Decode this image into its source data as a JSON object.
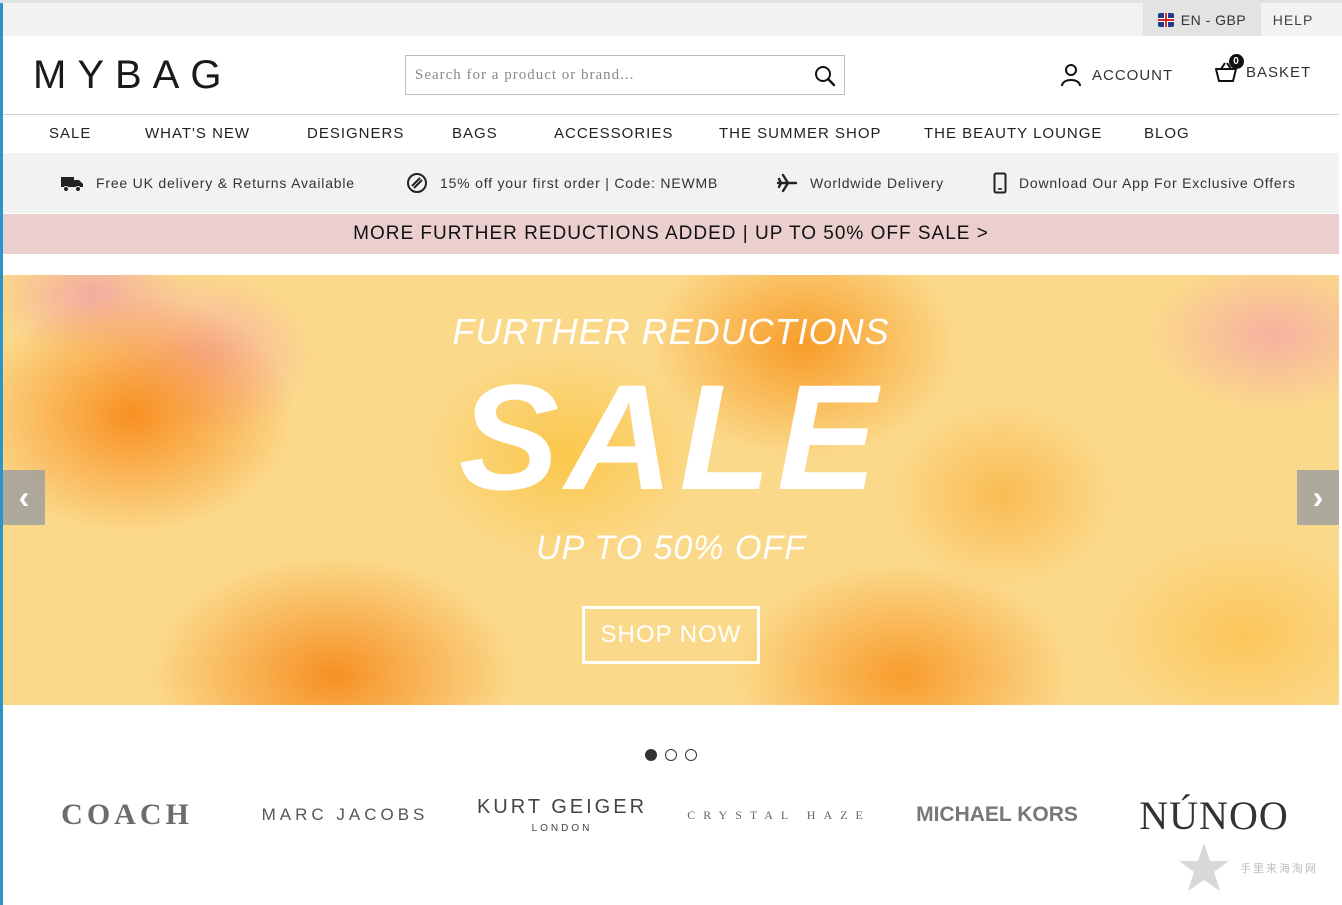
{
  "utility": {
    "locale": "EN - GBP",
    "help": "HELP"
  },
  "header": {
    "logo": "MYBAG",
    "search": {
      "placeholder": "Search for a product or brand..."
    },
    "account": "ACCOUNT",
    "basket": {
      "label": "BASKET",
      "count": "0"
    }
  },
  "nav": {
    "items": [
      {
        "label": "SALE"
      },
      {
        "label": "WHAT'S NEW"
      },
      {
        "label": "DESIGNERS"
      },
      {
        "label": "BAGS"
      },
      {
        "label": "ACCESSORIES"
      },
      {
        "label": "THE SUMMER SHOP"
      },
      {
        "label": "THE BEAUTY LOUNGE"
      },
      {
        "label": "BLOG"
      }
    ]
  },
  "usp": [
    {
      "icon": "delivery-truck-icon",
      "text": "Free UK delivery & Returns Available"
    },
    {
      "icon": "discount-icon",
      "text": "15% off your first order | Code: NEWMB"
    },
    {
      "icon": "plane-icon",
      "text": "Worldwide Delivery"
    },
    {
      "icon": "phone-icon",
      "text": "Download Our App For Exclusive Offers"
    }
  ],
  "promo": "MORE FURTHER REDUCTIONS ADDED | UP TO 50% OFF SALE >",
  "hero": {
    "pre": "FURTHER REDUCTIONS",
    "title": "SALE",
    "sub": "UP TO 50% OFF",
    "cta": "SHOP NOW",
    "prev": "‹",
    "next": "›",
    "slide_count": 3,
    "active_slide": 1
  },
  "brands": {
    "coach": "COACH",
    "marc_jacobs": "MARC JACOBS",
    "kurt_geiger": "KURT GEIGER",
    "kurt_geiger_sub": "LONDON",
    "crystal_haze": "CRYSTAL HAZE",
    "michael_kors": "MICHAEL KORS",
    "nunoo": "NÚNOO"
  },
  "watermark": "手里来海淘网",
  "colors": {
    "promo_bg": "#ebcfcf",
    "usp_bg": "#f2f2f2",
    "hero_orange": "#f78c1c",
    "accent_blue": "#2a95c9"
  }
}
